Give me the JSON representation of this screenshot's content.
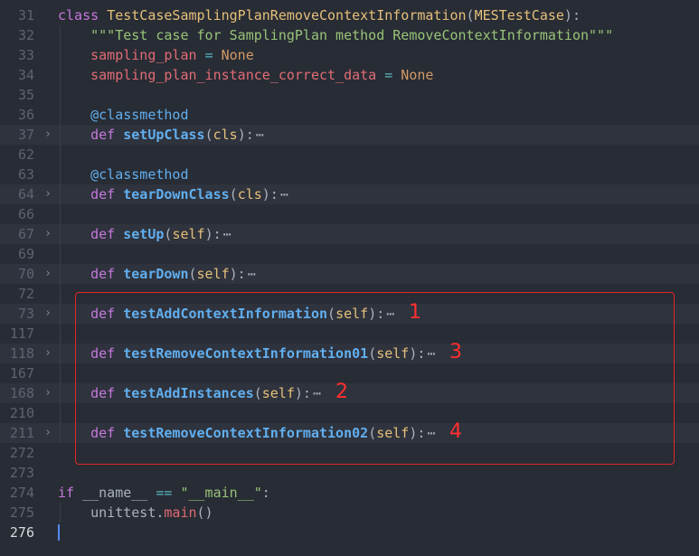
{
  "lines": [
    {
      "num": "31",
      "tokens": [
        [
          "kw",
          "class "
        ],
        [
          "cls",
          "TestCaseSamplingPlanRemoveContextInformation"
        ],
        [
          "plain",
          "("
        ],
        [
          "cls",
          "MESTestCase"
        ],
        [
          "plain",
          "):"
        ]
      ]
    },
    {
      "num": "32",
      "tokens": [
        [
          "plain",
          "    "
        ],
        [
          "str",
          "\"\"\"Test case for SamplingPlan method RemoveContextInformation\"\"\""
        ]
      ]
    },
    {
      "num": "33",
      "tokens": [
        [
          "plain",
          "    "
        ],
        [
          "var",
          "sampling_plan"
        ],
        [
          "plain",
          " "
        ],
        [
          "op",
          "="
        ],
        [
          "plain",
          " "
        ],
        [
          "const",
          "None"
        ]
      ]
    },
    {
      "num": "34",
      "tokens": [
        [
          "plain",
          "    "
        ],
        [
          "var",
          "sampling_plan_instance_correct_data"
        ],
        [
          "plain",
          " "
        ],
        [
          "op",
          "="
        ],
        [
          "plain",
          " "
        ],
        [
          "const",
          "None"
        ]
      ]
    },
    {
      "num": "35",
      "tokens": []
    },
    {
      "num": "36",
      "tokens": [
        [
          "plain",
          "    "
        ],
        [
          "deco",
          "@classmethod"
        ]
      ]
    },
    {
      "num": "37",
      "folded": true,
      "tokens": [
        [
          "plain",
          "    "
        ],
        [
          "kw",
          "def "
        ],
        [
          "fn",
          "setUpClass"
        ],
        [
          "plain",
          "("
        ],
        [
          "self",
          "cls"
        ],
        [
          "plain",
          "):"
        ],
        [
          "ell",
          "⋯"
        ]
      ]
    },
    {
      "num": "62",
      "tokens": []
    },
    {
      "num": "63",
      "tokens": [
        [
          "plain",
          "    "
        ],
        [
          "deco",
          "@classmethod"
        ]
      ]
    },
    {
      "num": "64",
      "folded": true,
      "tokens": [
        [
          "plain",
          "    "
        ],
        [
          "kw",
          "def "
        ],
        [
          "fn",
          "tearDownClass"
        ],
        [
          "plain",
          "("
        ],
        [
          "self",
          "cls"
        ],
        [
          "plain",
          "):"
        ],
        [
          "ell",
          "⋯"
        ]
      ]
    },
    {
      "num": "66",
      "tokens": []
    },
    {
      "num": "67",
      "folded": true,
      "tokens": [
        [
          "plain",
          "    "
        ],
        [
          "kw",
          "def "
        ],
        [
          "fn",
          "setUp"
        ],
        [
          "plain",
          "("
        ],
        [
          "self",
          "self"
        ],
        [
          "plain",
          "):"
        ],
        [
          "ell",
          "⋯"
        ]
      ]
    },
    {
      "num": "69",
      "tokens": []
    },
    {
      "num": "70",
      "folded": true,
      "tokens": [
        [
          "plain",
          "    "
        ],
        [
          "kw",
          "def "
        ],
        [
          "fn",
          "tearDown"
        ],
        [
          "plain",
          "("
        ],
        [
          "self",
          "self"
        ],
        [
          "plain",
          "):"
        ],
        [
          "ell",
          "⋯"
        ]
      ]
    },
    {
      "num": "72",
      "tokens": []
    },
    {
      "num": "73",
      "folded": true,
      "tokens": [
        [
          "plain",
          "    "
        ],
        [
          "kw",
          "def "
        ],
        [
          "fn",
          "testAddContextInformation"
        ],
        [
          "plain",
          "("
        ],
        [
          "self",
          "self"
        ],
        [
          "plain",
          "):"
        ],
        [
          "ell",
          "⋯"
        ]
      ]
    },
    {
      "num": "117",
      "tokens": []
    },
    {
      "num": "118",
      "folded": true,
      "tokens": [
        [
          "plain",
          "    "
        ],
        [
          "kw",
          "def "
        ],
        [
          "fn",
          "testRemoveContextInformation01"
        ],
        [
          "plain",
          "("
        ],
        [
          "self",
          "self"
        ],
        [
          "plain",
          "):"
        ],
        [
          "ell",
          "⋯"
        ]
      ]
    },
    {
      "num": "167",
      "tokens": []
    },
    {
      "num": "168",
      "folded": true,
      "tokens": [
        [
          "plain",
          "    "
        ],
        [
          "kw",
          "def "
        ],
        [
          "fn",
          "testAddInstances"
        ],
        [
          "plain",
          "("
        ],
        [
          "self",
          "self"
        ],
        [
          "plain",
          "):"
        ],
        [
          "ell",
          "⋯"
        ]
      ]
    },
    {
      "num": "210",
      "tokens": []
    },
    {
      "num": "211",
      "folded": true,
      "tokens": [
        [
          "plain",
          "    "
        ],
        [
          "kw",
          "def "
        ],
        [
          "fn",
          "testRemoveContextInformation02"
        ],
        [
          "plain",
          "("
        ],
        [
          "self",
          "self"
        ],
        [
          "plain",
          "):"
        ],
        [
          "ell",
          "⋯"
        ]
      ]
    },
    {
      "num": "272",
      "tokens": []
    },
    {
      "num": "273",
      "tokens": []
    },
    {
      "num": "274",
      "tokens": [
        [
          "kw",
          "if "
        ],
        [
          "plain",
          "__name__ "
        ],
        [
          "op",
          "=="
        ],
        [
          "plain",
          " "
        ],
        [
          "str",
          "\"__main__\""
        ],
        [
          "plain",
          ":"
        ]
      ]
    },
    {
      "num": "275",
      "tokens": [
        [
          "plain",
          "    unittest."
        ],
        [
          "var",
          "main"
        ],
        [
          "plain",
          "()"
        ]
      ]
    },
    {
      "num": "276",
      "current": true,
      "tokens": []
    }
  ],
  "annotations": [
    {
      "label": "1",
      "line_index": 15
    },
    {
      "label": "3",
      "line_index": 17
    },
    {
      "label": "2",
      "line_index": 19
    },
    {
      "label": "4",
      "line_index": 21
    }
  ],
  "fold_glyph": "›",
  "colors": {
    "background": "#282c34",
    "folded_line": "#2f333d",
    "highlight_box": "#e0262b",
    "annotation": "#ff3030"
  }
}
